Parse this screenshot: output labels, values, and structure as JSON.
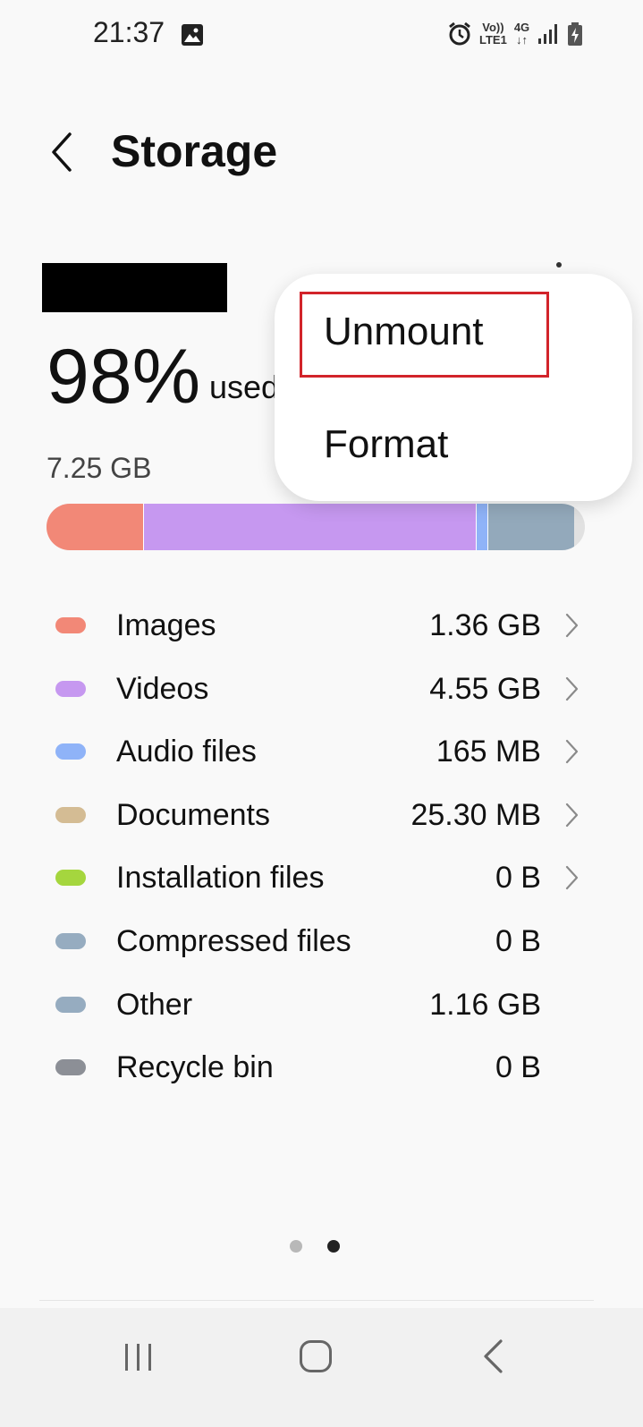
{
  "status_bar": {
    "time": "21:37",
    "net_top": "Vo))",
    "net_bottom": "LTE1",
    "net_type": "4G"
  },
  "header": {
    "title": "Storage"
  },
  "summary": {
    "percent": "98%",
    "used_label": "used",
    "total": "7.25 GB"
  },
  "usage_bar": [
    {
      "name": "Images",
      "color": "#f28877",
      "fraction": 0.18
    },
    {
      "name": "Videos",
      "color": "#c698f0",
      "fraction": 0.615
    },
    {
      "name": "Audio files",
      "color": "#8fb3f8",
      "fraction": 0.02
    },
    {
      "name": "Other",
      "color": "#93a9bb",
      "fraction": 0.16
    }
  ],
  "menu": {
    "unmount": "Unmount",
    "format": "Format"
  },
  "categories": [
    {
      "label": "Images",
      "size": "1.36 GB",
      "color": "#f28877",
      "chevron": true
    },
    {
      "label": "Videos",
      "size": "4.55 GB",
      "color": "#c698f0",
      "chevron": true
    },
    {
      "label": "Audio files",
      "size": "165 MB",
      "color": "#8fb3f8",
      "chevron": true
    },
    {
      "label": "Documents",
      "size": "25.30 MB",
      "color": "#d4bc94",
      "chevron": true
    },
    {
      "label": "Installation files",
      "size": "0 B",
      "color": "#a5d63e",
      "chevron": true
    },
    {
      "label": "Compressed files",
      "size": "0 B",
      "color": "#96acc0",
      "chevron": false
    },
    {
      "label": "Other",
      "size": "1.16 GB",
      "color": "#96acc0",
      "chevron": false
    },
    {
      "label": "Recycle bin",
      "size": "0 B",
      "color": "#8c8f96",
      "chevron": false
    }
  ],
  "pager": {
    "pages": 2,
    "current": 2
  },
  "nav": {
    "icons": [
      "recent-apps-icon",
      "home-icon",
      "back-icon"
    ]
  }
}
